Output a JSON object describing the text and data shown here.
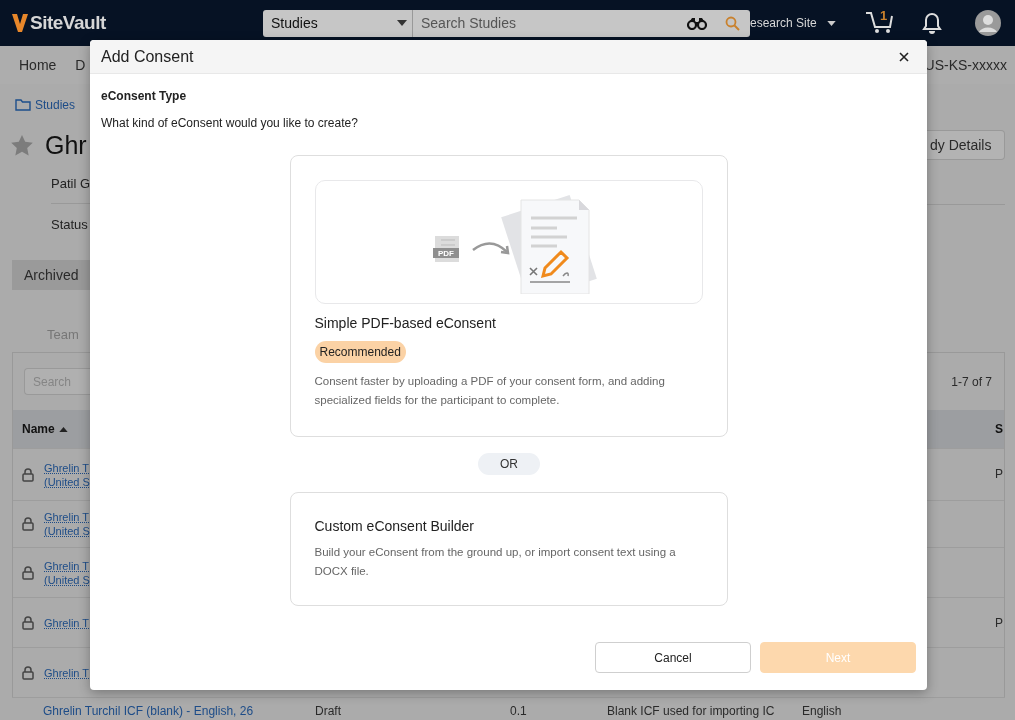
{
  "header": {
    "logo": "SiteVault",
    "search_scope": "Studies",
    "search_placeholder": "Search Studies",
    "site": "esearch Site",
    "cart_count": "1"
  },
  "nav": {
    "items": [
      "Home",
      "D"
    ],
    "study_id": "US-KS-xxxxx"
  },
  "study": {
    "breadcrumb": "Studies",
    "title": "Ghr",
    "favorite": false,
    "details_button": "dy Details",
    "info": [
      "Patil G",
      "Status"
    ],
    "status_badge": "Archived"
  },
  "tabs": [
    {
      "label": "Team",
      "selected": false
    }
  ],
  "table": {
    "search_placeholder": "Search",
    "pager": "1-7 of 7",
    "columns": [
      {
        "label": "Name",
        "sort_ascending": true
      },
      {
        "label": "S"
      }
    ],
    "rows": [
      {
        "name": "Ghrelin T (United S",
        "column_2": "P"
      },
      {
        "name": "Ghrelin T (United S"
      },
      {
        "name": "Ghrelin T (United S"
      },
      {
        "name": "Ghrelin T",
        "column_2": "P"
      },
      {
        "name": "Ghrelin T"
      }
    ],
    "last_row": {
      "name": "Ghrelin Turchil ICF (blank) - English, 26",
      "cells": [
        "Draft",
        "0.1",
        "Blank ICF used for importing IC",
        "English"
      ]
    }
  },
  "dialog": {
    "title": "Add Consent",
    "section": "eConsent Type",
    "question": "What kind of eConsent would you like to create?",
    "options": [
      {
        "kind": "illustrated",
        "illustration_label": "PDF",
        "title": "Simple PDF-based eConsent",
        "badge": "Recommended",
        "description": "Consent faster by uploading a PDF of your consent form, and adding specialized fields for the participant to complete.",
        "selected": false
      },
      {
        "kind": "plain",
        "title": "Custom eConsent Builder",
        "description": "Build your eConsent from the ground up, or import consent text using a DOCX file.",
        "selected": false
      }
    ],
    "separator": "OR",
    "buttons": [
      {
        "label": "Cancel",
        "kind": "secondary",
        "disabled": false
      },
      {
        "label": "Next",
        "kind": "primary",
        "disabled": true
      }
    ]
  }
}
